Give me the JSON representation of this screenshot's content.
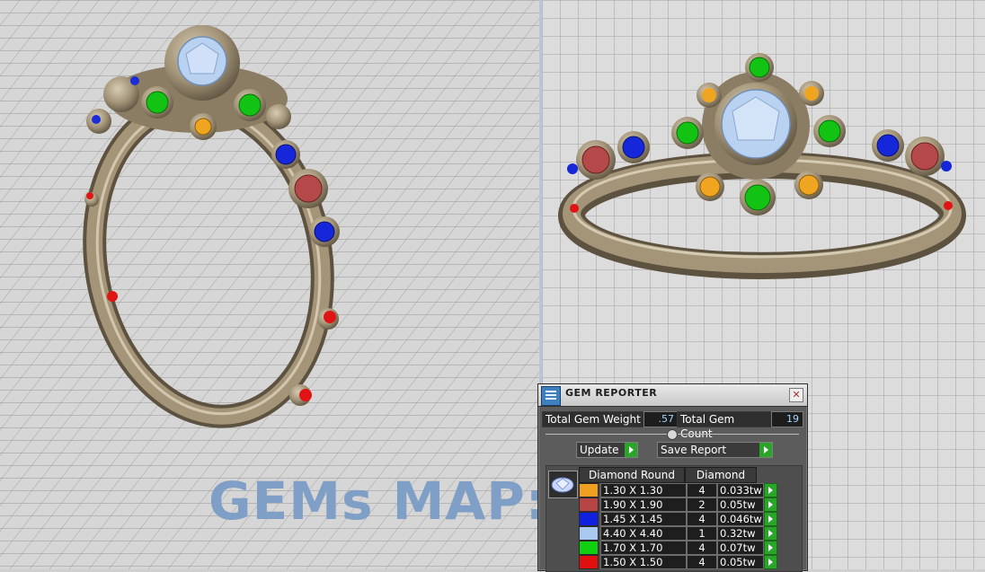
{
  "watermark_text": "GEMs MAP:",
  "colors": {
    "metal": "#a49579",
    "grid_bg": "#d6d6d6",
    "grid_line": "#8c8c8c",
    "panel_bg": "#5c5c5c",
    "accent_green": "#2aa52a",
    "watermark": "#7f9fc6"
  },
  "gem_reporter": {
    "title": "GEM REPORTER",
    "icon": "gem-reporter-app-icon",
    "close_icon": "close-icon",
    "total_gem_weight_label": "Total Gem Weight",
    "total_gem_weight_value": ".57",
    "total_gem_count_label": "Total Gem Count",
    "total_gem_count_value": "19",
    "update_label": "Update",
    "save_report_label": "Save Report",
    "table": {
      "col_shape": "Diamond Round",
      "col_material": "Diamond",
      "rows": [
        {
          "color": "#f0a020",
          "size": "1.30 X 1.30",
          "count": "4",
          "ct": "0.033tw"
        },
        {
          "color": "#b84545",
          "size": "1.90 X 1.90",
          "count": "2",
          "ct": "0.05tw"
        },
        {
          "color": "#1020e0",
          "size": "1.45 X 1.45",
          "count": "4",
          "ct": "0.046tw"
        },
        {
          "color": "#a9c8ef",
          "size": "4.40 X 4.40",
          "count": "1",
          "ct": "0.32tw"
        },
        {
          "color": "#10d010",
          "size": "1.70 X 1.70",
          "count": "4",
          "ct": "0.07tw"
        },
        {
          "color": "#e01010",
          "size": "1.50 X 1.50",
          "count": "4",
          "ct": "0.05tw"
        }
      ]
    }
  }
}
